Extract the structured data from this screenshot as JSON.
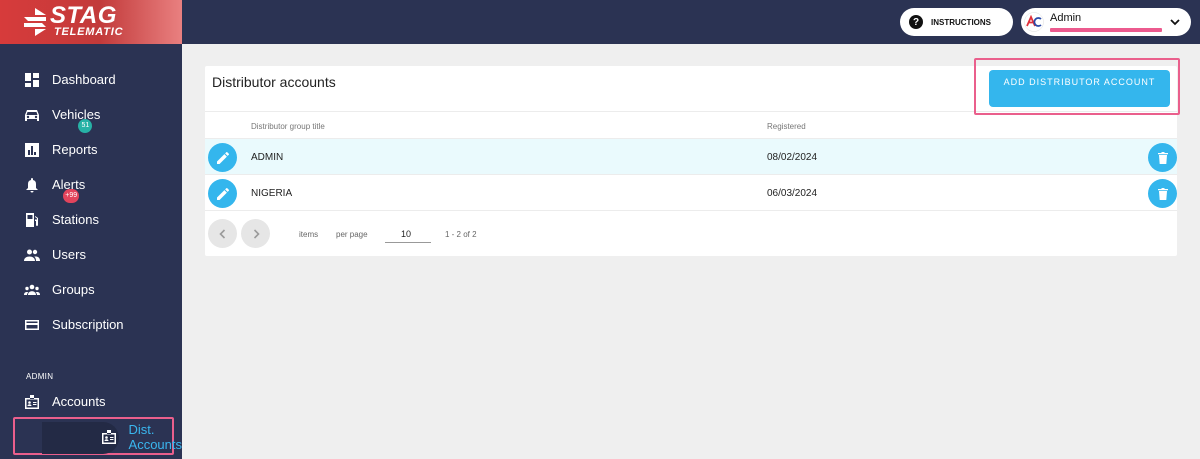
{
  "app": {
    "logo_line1": "STAG",
    "logo_line2": "TELEMATIC"
  },
  "topbar": {
    "instructions_label": "INSTRUCTIONS",
    "user_name": "Admin"
  },
  "sidebar": {
    "items": [
      {
        "label": "Dashboard",
        "icon": "dashboard-icon"
      },
      {
        "label": "Vehicles",
        "icon": "car-icon",
        "badge": "51"
      },
      {
        "label": "Reports",
        "icon": "bar-chart-icon"
      },
      {
        "label": "Alerts",
        "icon": "bell-icon",
        "badge": "+99"
      },
      {
        "label": "Stations",
        "icon": "fuel-station-icon"
      },
      {
        "label": "Users",
        "icon": "users-icon"
      },
      {
        "label": "Groups",
        "icon": "groups-icon"
      },
      {
        "label": "Subscription",
        "icon": "credit-card-icon"
      }
    ],
    "admin_section_label": "ADMIN",
    "admin_items": [
      {
        "label": "Accounts",
        "icon": "account-card-icon"
      },
      {
        "label": "Dist. Accounts",
        "icon": "account-card-icon",
        "active": true
      }
    ]
  },
  "main": {
    "title": "Distributor accounts",
    "add_button_label": "ADD DISTRIBUTOR ACCOUNT",
    "table": {
      "columns": [
        "Distributor group title",
        "Registered"
      ],
      "rows": [
        {
          "title": "ADMIN",
          "registered": "08/02/2024",
          "selected": true
        },
        {
          "title": "NIGERIA",
          "registered": "06/03/2024",
          "selected": false
        }
      ]
    },
    "pagination": {
      "items_label": "items",
      "per_page_label": "per page",
      "per_page_value": "10",
      "range_text": "1 - 2 of 2"
    }
  },
  "colors": {
    "sidebar_bg": "#2b3353",
    "accent": "#34b6ed",
    "badge_teal": "#27b2a6",
    "badge_red": "#e2445c",
    "highlight": "#ea5f8c",
    "logo_red": "#d73b3b"
  }
}
